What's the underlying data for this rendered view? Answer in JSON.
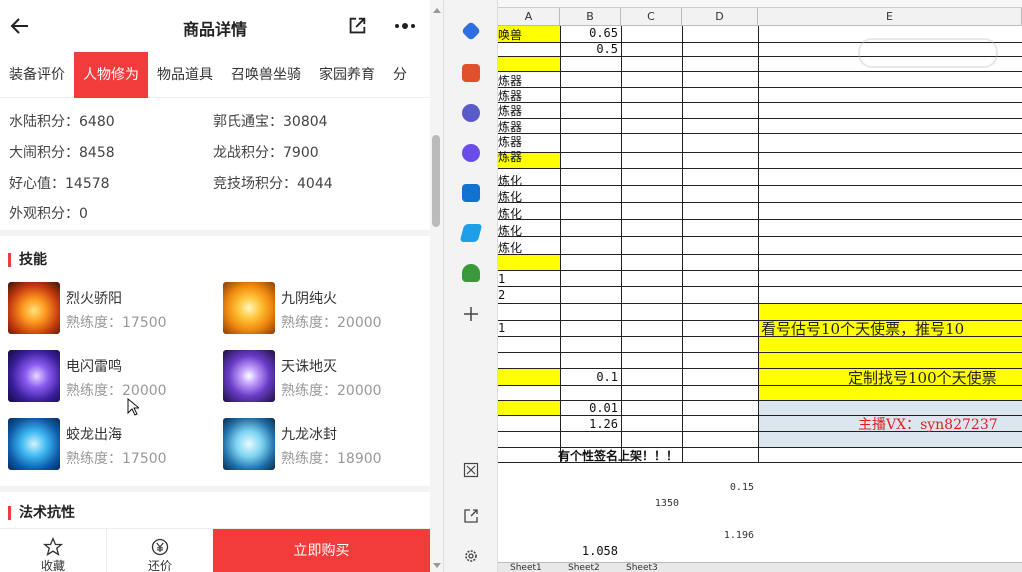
{
  "header": {
    "title": "商品详情"
  },
  "tabs": [
    {
      "label": "装备评价"
    },
    {
      "label": "人物修为",
      "active": true
    },
    {
      "label": "物品道具"
    },
    {
      "label": "召唤兽坐骑"
    },
    {
      "label": "家园养育"
    },
    {
      "label": "分"
    }
  ],
  "stats": [
    {
      "label": "水陆积分：",
      "value": "6480"
    },
    {
      "label": "郭氏通宝：",
      "value": "30804"
    },
    {
      "label": "大闹积分：",
      "value": "8458"
    },
    {
      "label": "龙战积分：",
      "value": "7900"
    },
    {
      "label": "好心值：",
      "value": "14578"
    },
    {
      "label": "竞技场积分：",
      "value": "4044"
    },
    {
      "label": "外观积分：",
      "value": "0"
    }
  ],
  "skills_section": {
    "title": "技能"
  },
  "skills": [
    {
      "name": "烈火骄阳",
      "exp": "熟练度：17500",
      "icon": "fire-skill-icon"
    },
    {
      "name": "九阴纯火",
      "exp": "熟练度：20000",
      "icon": "yin-yang-fire-icon"
    },
    {
      "name": "电闪雷鸣",
      "exp": "熟练度：20000",
      "icon": "lightning-skill-icon"
    },
    {
      "name": "天诛地灭",
      "exp": "熟练度：20000",
      "icon": "purple-orb-icon"
    },
    {
      "name": "蛟龙出海",
      "exp": "熟练度：17500",
      "icon": "water-dragon-icon"
    },
    {
      "name": "九龙冰封",
      "exp": "熟练度：18900",
      "icon": "ice-dragon-icon"
    }
  ],
  "resist_section": {
    "title": "法术抗性"
  },
  "bottom": {
    "favorite": "收藏",
    "bargain": "还价",
    "buy": "立即购买"
  },
  "sheet": {
    "col_headers": [
      "A",
      "B",
      "C",
      "D",
      "E"
    ],
    "a_cells": [
      "唤兽",
      "炼器",
      "炼器",
      "炼器",
      "炼器",
      "炼器",
      "炼器",
      "炼化",
      "炼化",
      "炼化",
      "炼化",
      "炼化",
      "1",
      "2",
      "1"
    ],
    "b_values": [
      "0.65",
      "0.5",
      "0.1",
      "0.01",
      "1.26"
    ],
    "note": "有个性签名上架！！！",
    "small_values": [
      "0.15",
      "1350",
      "1.196",
      "1.058"
    ],
    "banner1": "看号估号10个天使票，推号10",
    "banner2": "定制找号100个天使票",
    "banner3": "主播VX：syn827237",
    "sheet_tabs": [
      "Sheet1",
      "Sheet2",
      "Sheet3"
    ]
  }
}
